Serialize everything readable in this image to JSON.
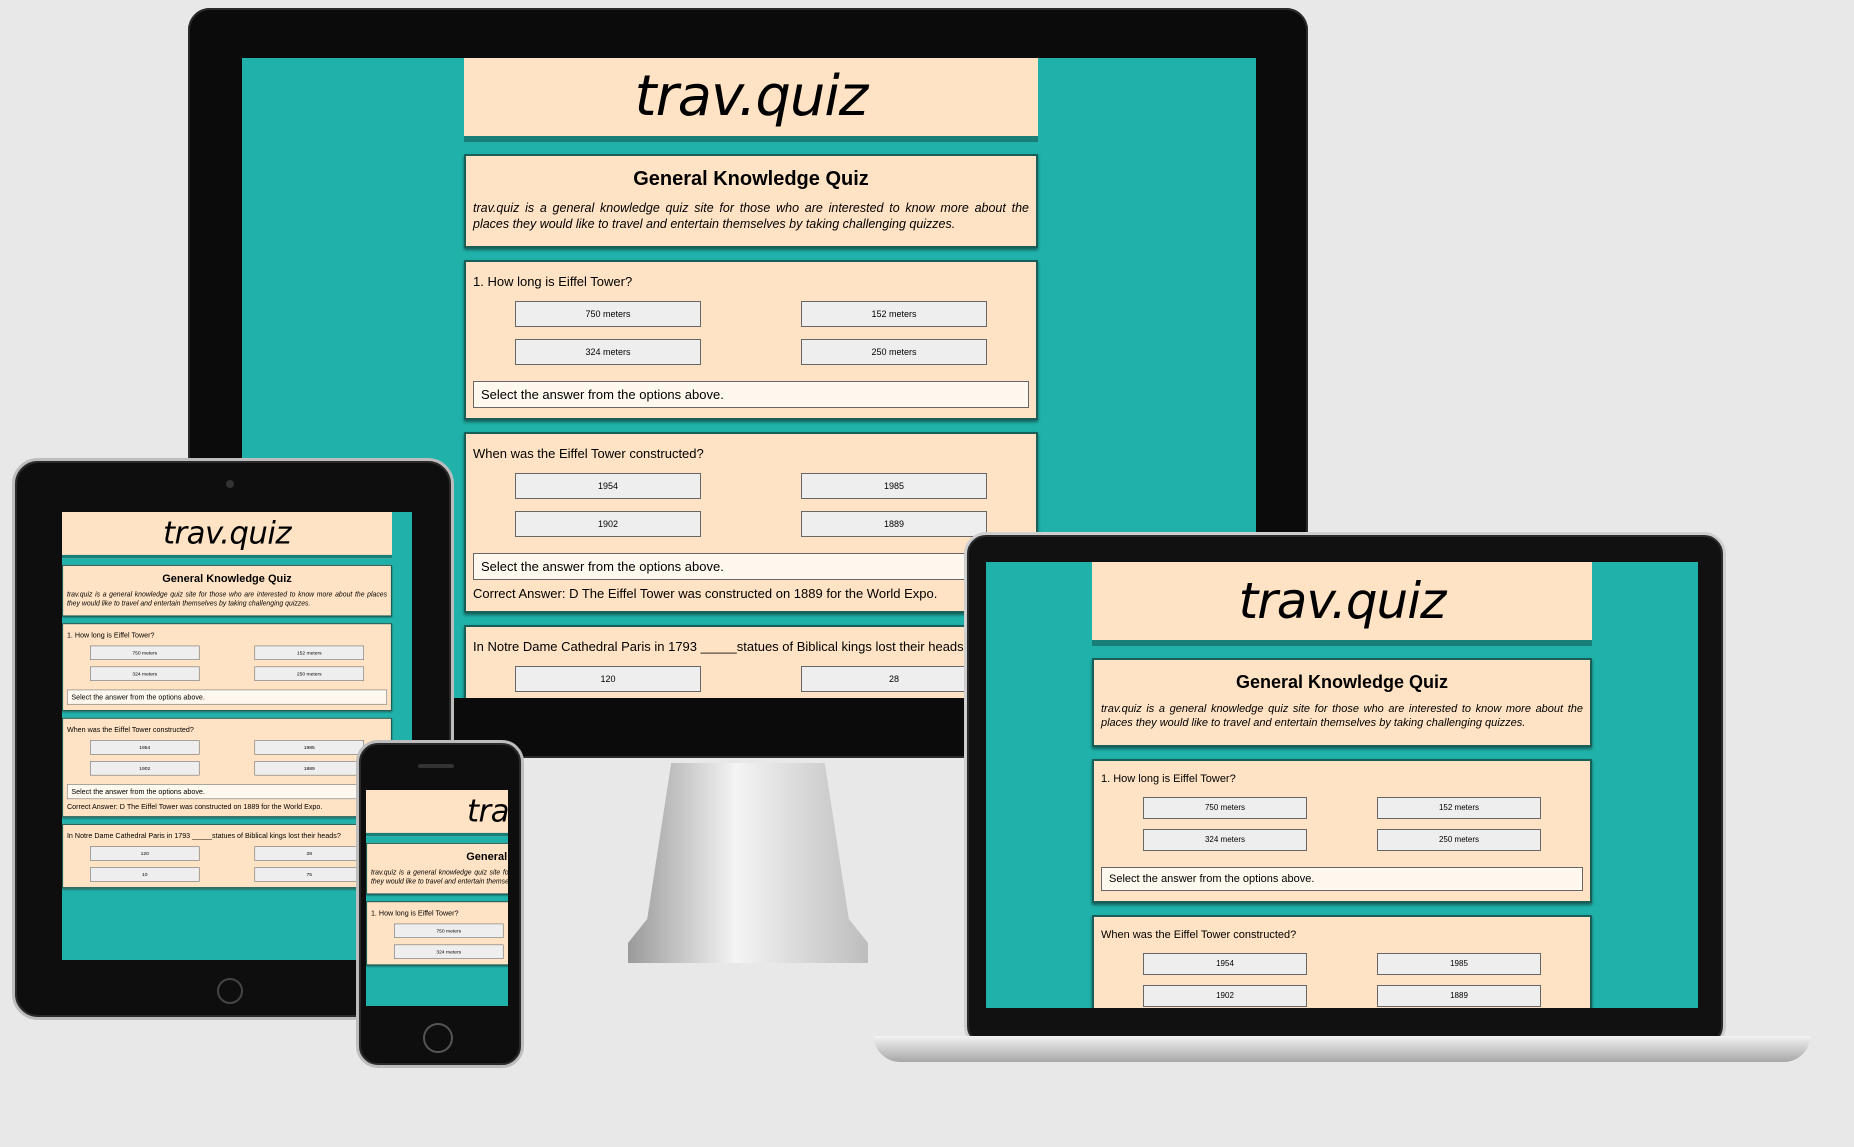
{
  "site": {
    "logo": "trav.quiz",
    "title": "General Knowledge Quiz",
    "intro": "trav.quiz is a general knowledge quiz site for those who are interested to know more about the places they would like to travel and entertain themselves by taking challenging quizzes.",
    "status_text": "Select the answer from the options above.",
    "questions": [
      {
        "text": "1. How long is Eiffel Tower?",
        "options": [
          "750 meters",
          "152 meters",
          "324 meters",
          "250 meters"
        ]
      },
      {
        "text": "When was the Eiffel Tower constructed?",
        "options": [
          "1954",
          "1985",
          "1902",
          "1889"
        ],
        "answer": "Correct Answer: D The Eiffel Tower was constructed on 1889 for the World Expo."
      },
      {
        "text": "In Notre Dame Cathedral Paris in 1793 _____statues of Biblical kings lost their heads?",
        "options": [
          "120",
          "28",
          "10",
          "75"
        ]
      }
    ]
  },
  "colors": {
    "background": "#20b2aa",
    "panel": "#ffe3c4",
    "accent": "#197e78"
  }
}
